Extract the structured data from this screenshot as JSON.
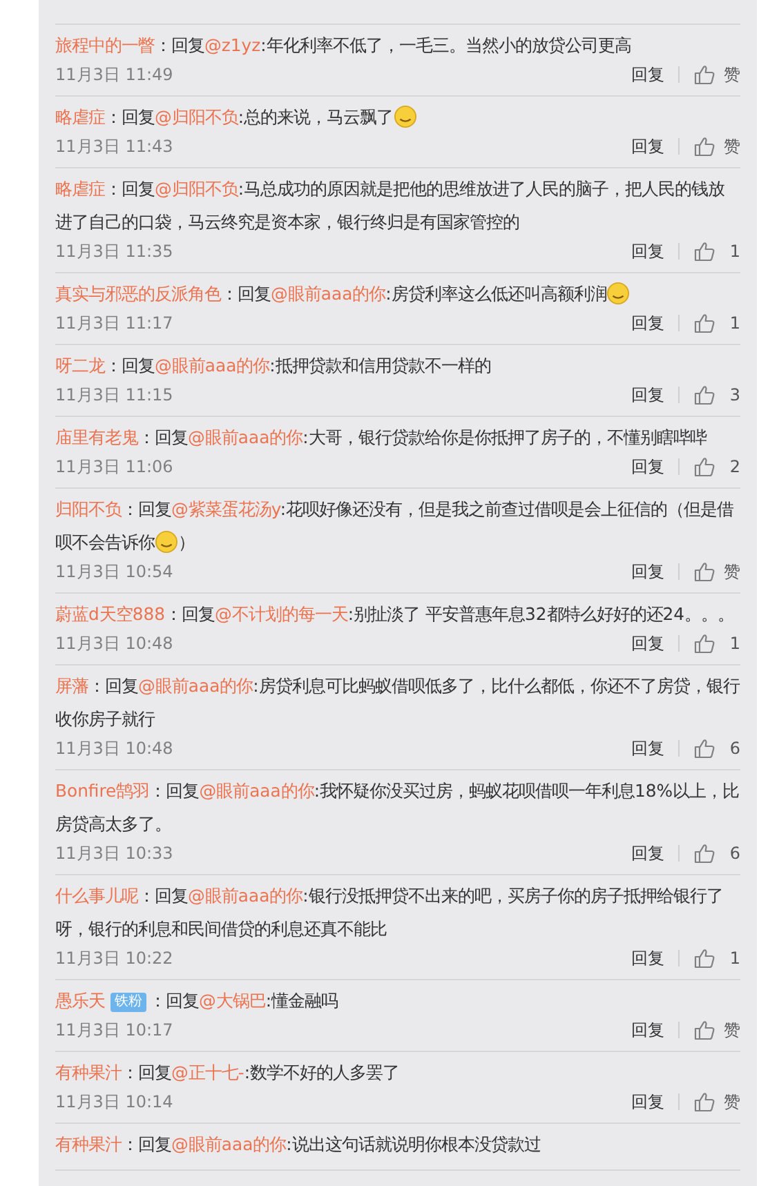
{
  "comments": [
    {
      "author": "旅程中的一瞥",
      "prefix": "：回复",
      "mention": "@z1yz",
      "text": ":年化利率不低了，一毛三。当然小的放贷公司更高",
      "time": "11月3日 11:49",
      "reply": "回复",
      "likes": "赞"
    },
    {
      "author": "略虐症",
      "prefix": "：回复",
      "mention": "@归阳不负",
      "text": ":总的来说，马云飘了",
      "emoji": true,
      "time": "11月3日 11:43",
      "reply": "回复",
      "likes": "赞"
    },
    {
      "author": "略虐症",
      "prefix": "：回复",
      "mention": "@归阳不负",
      "text": ":马总成功的原因就是把他的思维放进了人民的脑子，把人民的钱放进了自己的口袋，马云终究是资本家，银行终归是有国家管控的",
      "time": "11月3日 11:35",
      "reply": "回复",
      "likes": "1"
    },
    {
      "author": "真实与邪恶的反派角色",
      "prefix": "：回复",
      "mention": "@眼前aaa的你",
      "text": ":房贷利率这么低还叫高额利润",
      "emoji": true,
      "time": "11月3日 11:17",
      "reply": "回复",
      "likes": "1"
    },
    {
      "author": "呀二龙",
      "prefix": "：回复",
      "mention": "@眼前aaa的你",
      "text": ":抵押贷款和信用贷款不一样的",
      "time": "11月3日 11:15",
      "reply": "回复",
      "likes": "3"
    },
    {
      "author": "庙里有老鬼",
      "prefix": "：回复",
      "mention": "@眼前aaa的你",
      "text": ":大哥，银行贷款给你是你抵押了房子的，不懂别瞎哔哔",
      "time": "11月3日 11:06",
      "reply": "回复",
      "likes": "2"
    },
    {
      "author": "归阳不负",
      "prefix": "：回复",
      "mention": "@紫菜蛋花汤y",
      "text": ":花呗好像还没有，但是我之前查过借呗是会上征信的（但是借呗不会告诉你",
      "emoji": true,
      "text_after": "）",
      "time": "11月3日 10:54",
      "reply": "回复",
      "likes": "赞"
    },
    {
      "author": "蔚蓝d天空888",
      "prefix": "：回复",
      "mention": "@不计划的每一天",
      "text": ":别扯淡了 平安普惠年息32都特么好好的还24。。。",
      "time": "11月3日 10:48",
      "reply": "回复",
      "likes": "1"
    },
    {
      "author": "屏藩",
      "prefix": "：回复",
      "mention": "@眼前aaa的你",
      "text": ":房贷利息可比蚂蚁借呗低多了，比什么都低，你还不了房贷，银行收你房子就行",
      "time": "11月3日 10:48",
      "reply": "回复",
      "likes": "6"
    },
    {
      "author": "Bonfire鹄羽",
      "prefix": "：回复",
      "mention": "@眼前aaa的你",
      "text": ":我怀疑你没买过房，蚂蚁花呗借呗一年利息18%以上，比房贷高太多了。",
      "time": "11月3日 10:33",
      "reply": "回复",
      "likes": "6"
    },
    {
      "author": "什么事儿呢",
      "prefix": "：回复",
      "mention": "@眼前aaa的你",
      "text": ":银行没抵押贷不出来的吧，买房子你的房子抵押给银行了呀，银行的利息和民间借贷的利息还真不能比",
      "time": "11月3日 10:22",
      "reply": "回复",
      "likes": "1"
    },
    {
      "author": "愚乐天",
      "badge": "铁粉",
      "prefix": "：回复",
      "mention": "@大锅巴",
      "text": ":懂金融吗",
      "time": "11月3日 10:17",
      "reply": "回复",
      "likes": "赞"
    },
    {
      "author": "有种果汁",
      "prefix": "：回复",
      "mention": "@正十七-",
      "text": ":数学不好的人多罢了",
      "time": "11月3日 10:14",
      "reply": "回复",
      "likes": "赞"
    },
    {
      "author": "有种果汁",
      "prefix": "：回复",
      "mention": "@眼前aaa的你",
      "text": ":说出这句话就说明你根本没贷款过"
    }
  ]
}
